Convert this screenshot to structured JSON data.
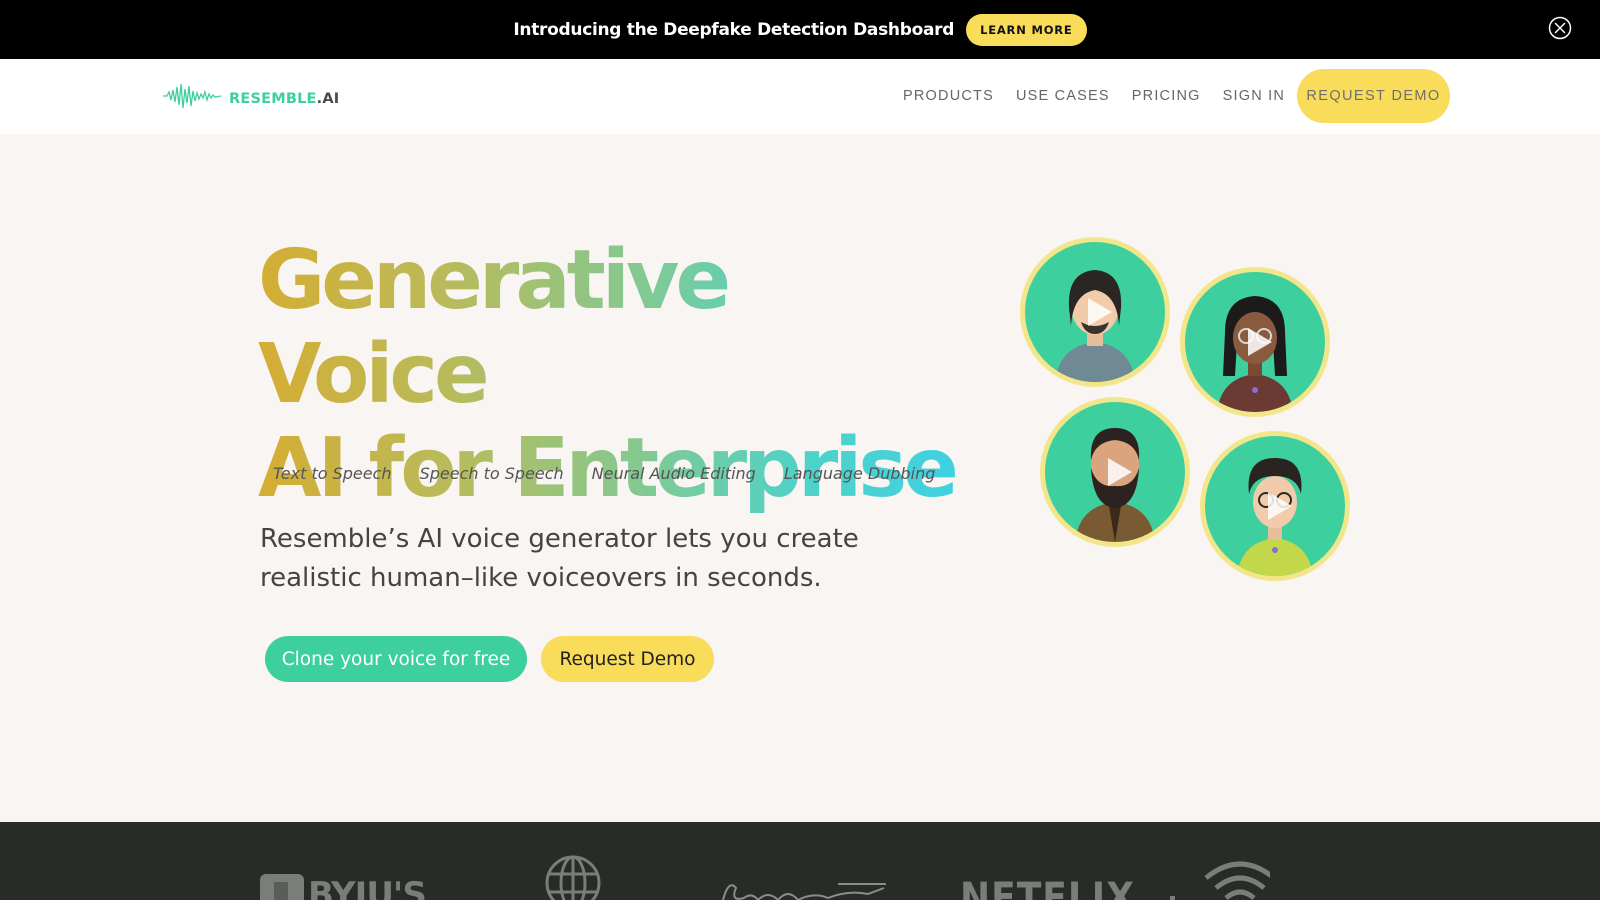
{
  "announcement": {
    "text": "Introducing the Deepfake Detection Dashboard",
    "button_label": "LEARN MORE"
  },
  "nav": {
    "logo_brand": "RESEMBLE",
    "logo_suffix": ".AI",
    "links": [
      "PRODUCTS",
      "USE CASES",
      "PRICING",
      "SIGN IN"
    ],
    "cta_label": "REQUEST DEMO"
  },
  "hero": {
    "headline_line1": "Generative Voice",
    "headline_line2": "AI for Enterprise",
    "features": [
      "Text to Speech",
      "Speech to Speech",
      "Neural Audio Editing",
      "Language Dubbing"
    ],
    "description": "Resemble’s AI voice generator lets you create realistic human–like voiceovers in seconds.",
    "primary_button": "Clone your voice for free",
    "secondary_button": "Request Demo"
  },
  "customers": {
    "logo_texts": [
      "BYJU'S",
      "NETFLIX"
    ]
  },
  "colors": {
    "accent_green": "#3ecf9e",
    "accent_yellow": "#f8dc5a",
    "announcement_bg": "#000000",
    "hero_bg": "#f8f5f2",
    "logos_bg": "#282c28"
  }
}
